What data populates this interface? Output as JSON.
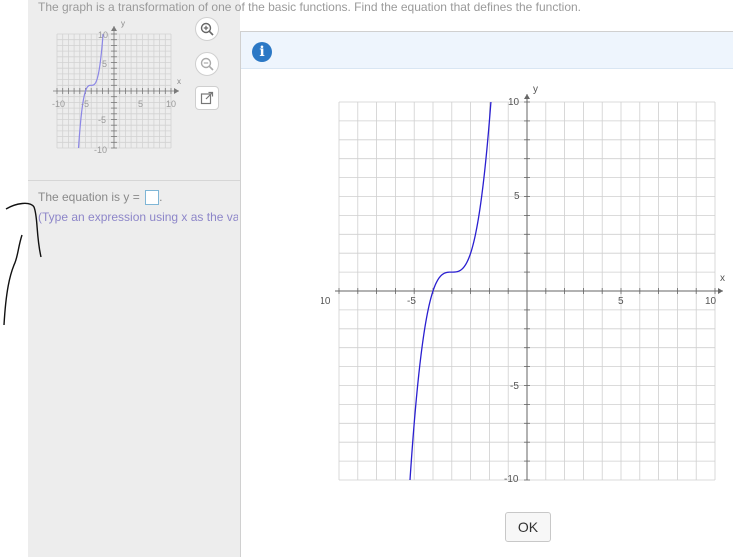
{
  "question": {
    "text": "The graph is a transformation of one of the basic functions. Find the equation that defines the function."
  },
  "thumbnail_graph": {
    "x_axis_label": "x",
    "y_axis_label": "y",
    "tick_labels": {
      "x_neg": "-10",
      "x_neg_half": "-5",
      "x_pos_half": "5",
      "x_pos": "10",
      "y_pos": "10",
      "y_pos_half": "5",
      "y_neg_half": "-5",
      "y_neg": "-10"
    }
  },
  "tools": {
    "zoom_in_icon": "zoom-in-icon",
    "zoom_out_icon": "zoom-out-icon",
    "popout_icon": "popout-icon"
  },
  "answer": {
    "prefix": "The equation is y =",
    "suffix": ".",
    "value": "",
    "hint": "(Type an expression using x as the variable.)"
  },
  "dialog": {
    "info_icon": "i",
    "ok_label": "OK"
  },
  "main_graph": {
    "x_axis_label": "x",
    "y_axis_label": "y",
    "x_ticks": [
      "-10",
      "-5",
      "5",
      "10"
    ],
    "y_ticks": [
      "10",
      "5",
      "-5",
      "-10"
    ]
  },
  "chart_data": {
    "type": "line",
    "title": "",
    "xlabel": "x",
    "ylabel": "y",
    "xlim": [
      -10,
      10
    ],
    "ylim": [
      -10,
      10
    ],
    "grid": true,
    "series": [
      {
        "color": "#2a1fd0",
        "h": -4,
        "k": 1,
        "x": [
          -6.3,
          -6,
          -5.5,
          -5,
          -4.5,
          -4,
          -3.5,
          -3,
          -2.5,
          -2.1
        ],
        "y": [
          -10.0,
          -7.0,
          -2.4,
          0.0,
          0.9,
          1.0,
          1.1,
          2.0,
          4.4,
          7.9
        ]
      }
    ],
    "colors": {
      "curve": "#2a1fd0",
      "grid": "#cfcfcf",
      "axis": "#666666"
    }
  }
}
